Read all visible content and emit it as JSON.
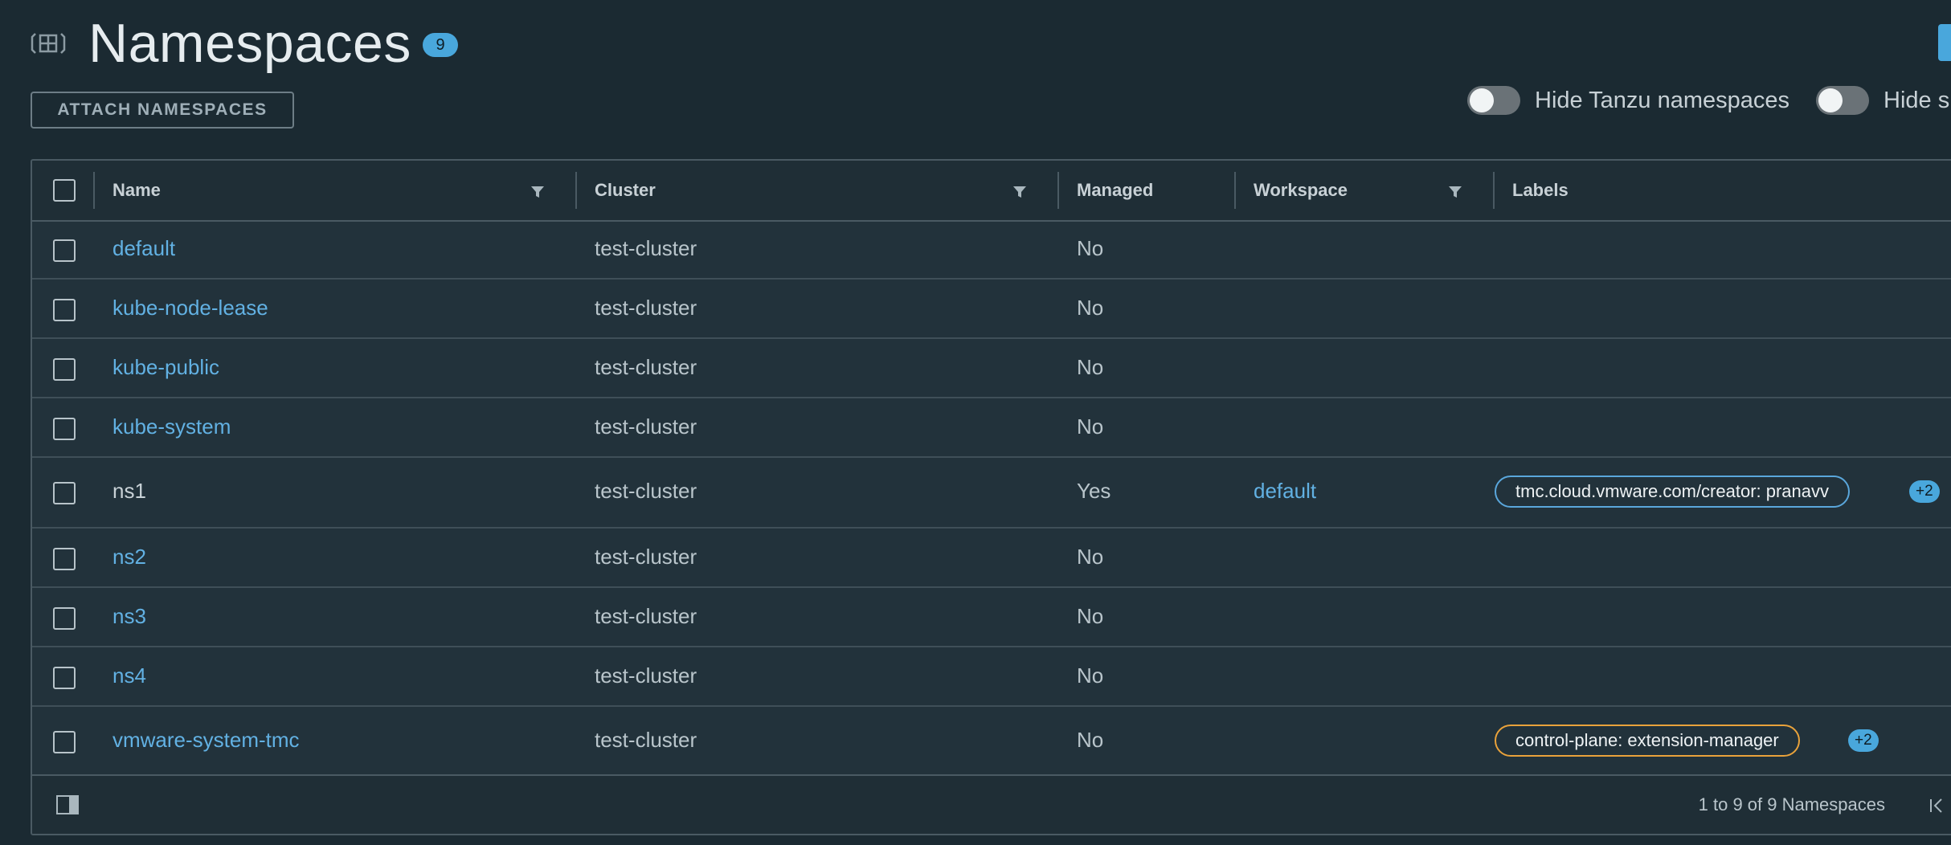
{
  "header": {
    "title": "Namespaces",
    "count": "9",
    "attach_label": "ATTACH NAMESPACES",
    "toggles": [
      {
        "label": "Hide Tanzu namespaces",
        "on": false
      },
      {
        "label": "Hide s",
        "on": false
      }
    ]
  },
  "table": {
    "columns": [
      "Name",
      "Cluster",
      "Managed",
      "Workspace",
      "Labels"
    ],
    "rows": [
      {
        "name": "default",
        "cluster": "test-cluster",
        "managed": "No",
        "workspace": "",
        "label": "",
        "more": ""
      },
      {
        "name": "kube-node-lease",
        "cluster": "test-cluster",
        "managed": "No",
        "workspace": "",
        "label": "",
        "more": ""
      },
      {
        "name": "kube-public",
        "cluster": "test-cluster",
        "managed": "No",
        "workspace": "",
        "label": "",
        "more": ""
      },
      {
        "name": "kube-system",
        "cluster": "test-cluster",
        "managed": "No",
        "workspace": "",
        "label": "",
        "more": ""
      },
      {
        "name": "ns1",
        "cluster": "test-cluster",
        "managed": "Yes",
        "workspace": "default",
        "label": "tmc.cloud.vmware.com/creator: pranavv",
        "more": "+2"
      },
      {
        "name": "ns2",
        "cluster": "test-cluster",
        "managed": "No",
        "workspace": "",
        "label": "",
        "more": ""
      },
      {
        "name": "ns3",
        "cluster": "test-cluster",
        "managed": "No",
        "workspace": "",
        "label": "",
        "more": ""
      },
      {
        "name": "ns4",
        "cluster": "test-cluster",
        "managed": "No",
        "workspace": "",
        "label": "",
        "more": ""
      },
      {
        "name": "vmware-system-tmc",
        "cluster": "test-cluster",
        "managed": "No",
        "workspace": "",
        "label": "control-plane: extension-manager",
        "more": "+2"
      }
    ],
    "footer": {
      "pagination": "1 to 9 of 9 Namespaces"
    }
  },
  "colors": {
    "background": "#1b2a32",
    "link": "#62b1e3",
    "accent": "#49a7dc",
    "label_border_blue": "#5aa7dc",
    "label_border_orange": "#e9a23b"
  },
  "icons": [
    "namespace-icon",
    "filter-icon",
    "column-toggle-icon",
    "first-page-icon"
  ]
}
